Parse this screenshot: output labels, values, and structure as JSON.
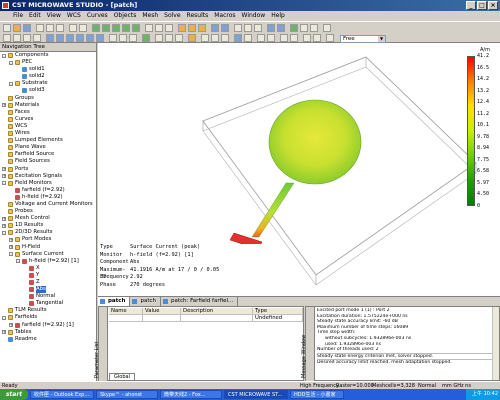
{
  "window": {
    "title": "CST MICROWAVE STUDIO - [patch]"
  },
  "menu": [
    "File",
    "Edit",
    "View",
    "WCS",
    "Curves",
    "Objects",
    "Mesh",
    "Solve",
    "Results",
    "Macros",
    "Window",
    "Help"
  ],
  "toolbar": {
    "view_mode": "Free"
  },
  "navtree": {
    "title": "Navigation Tree",
    "items": [
      {
        "label": "Components",
        "expander": "-",
        "icon": "folder"
      },
      {
        "label": "PEC",
        "expander": "-",
        "icon": "folder"
      },
      {
        "label": "solid1",
        "expander": "",
        "icon": "solid"
      },
      {
        "label": "solid2",
        "expander": "",
        "icon": "solid"
      },
      {
        "label": "Substrate",
        "expander": "-",
        "icon": "folder"
      },
      {
        "label": "solid3",
        "expander": "",
        "icon": "solid"
      },
      {
        "label": "Groups",
        "expander": "",
        "icon": "folder"
      },
      {
        "label": "Materials",
        "expander": "+",
        "icon": "folder"
      },
      {
        "label": "Faces",
        "expander": "",
        "icon": "folder"
      },
      {
        "label": "Curves",
        "expander": "",
        "icon": "folder"
      },
      {
        "label": "WCS",
        "expander": "",
        "icon": "folder"
      },
      {
        "label": "Wires",
        "expander": "",
        "icon": "folder"
      },
      {
        "label": "Lumped Elements",
        "expander": "",
        "icon": "folder"
      },
      {
        "label": "Plane Wave",
        "expander": "",
        "icon": "folder"
      },
      {
        "label": "Farfield Source",
        "expander": "",
        "icon": "folder"
      },
      {
        "label": "Field Sources",
        "expander": "",
        "icon": "folder"
      },
      {
        "label": "Ports",
        "expander": "+",
        "icon": "folder"
      },
      {
        "label": "Excitation Signals",
        "expander": "+",
        "icon": "folder"
      },
      {
        "label": "Field Monitors",
        "expander": "-",
        "icon": "folder"
      },
      {
        "label": "farfield (f=2.92)",
        "expander": "",
        "icon": "mon"
      },
      {
        "label": "h-field (f=2.92)",
        "expander": "",
        "icon": "mon"
      },
      {
        "label": "Voltage and Current Monitors",
        "expander": "",
        "icon": "folder"
      },
      {
        "label": "Probes",
        "expander": "",
        "icon": "folder"
      },
      {
        "label": "Mesh Control",
        "expander": "+",
        "icon": "folder"
      },
      {
        "label": "1D Results",
        "expander": "+",
        "icon": "folder"
      },
      {
        "label": "2D/3D Results",
        "expander": "-",
        "icon": "folder"
      },
      {
        "label": "Port Modes",
        "expander": "+",
        "icon": "folder"
      },
      {
        "label": "H-Field",
        "expander": "+",
        "icon": "folder"
      },
      {
        "label": "Surface Current",
        "expander": "-",
        "icon": "folder"
      },
      {
        "label": "h-field (f=2.92) [1]",
        "expander": "-",
        "icon": "mon"
      },
      {
        "label": "X",
        "expander": "",
        "icon": "mon"
      },
      {
        "label": "Y",
        "expander": "",
        "icon": "mon"
      },
      {
        "label": "Z",
        "expander": "",
        "icon": "mon"
      },
      {
        "label": "Abs",
        "expander": "",
        "icon": "mon",
        "selected": true
      },
      {
        "label": "Normal",
        "expander": "",
        "icon": "mon"
      },
      {
        "label": "Tangential",
        "expander": "",
        "icon": "mon"
      },
      {
        "label": "TLM Results",
        "expander": "",
        "icon": "folder"
      },
      {
        "label": "Farfields",
        "expander": "-",
        "icon": "folder"
      },
      {
        "label": "farfield (f=2.92) [1]",
        "expander": "+",
        "icon": "mon"
      },
      {
        "label": "Tables",
        "expander": "+",
        "icon": "folder"
      },
      {
        "label": "Readme",
        "expander": "",
        "icon": "solid"
      }
    ]
  },
  "info": [
    {
      "key": "Type",
      "value": "Surface Current (peak)"
    },
    {
      "key": "Monitor",
      "value": "h-field (f=2.92) [1]"
    },
    {
      "key": "Component",
      "value": "Abs"
    },
    {
      "key": "Maximum-3D",
      "value": "41.1916 A/m at 17 / 0 / 0.05"
    },
    {
      "key": "Frequency",
      "value": "2.92"
    },
    {
      "key": "Phase",
      "value": "270 degrees"
    }
  ],
  "legend": {
    "unit": "A/m",
    "ticks": [
      "41.2",
      "16.5",
      "14.2",
      "13.2",
      "12.4",
      "11.2",
      "10.1",
      "9.78",
      "8.94",
      "7.75",
      "6.58",
      "5.97",
      "4.50",
      "0"
    ]
  },
  "colors": {
    "patch": "#cde233",
    "feed": "#7dcf3a",
    "port": "#e03030",
    "board_edge": "#9a9a9a"
  },
  "view_tabs": [
    {
      "label": "patch",
      "active": true
    },
    {
      "label": "patch",
      "active": false
    },
    {
      "label": "patch: Farfield farfiel...",
      "active": false
    }
  ],
  "params": {
    "title": "Parameter List",
    "headers": [
      "Name",
      "Value",
      "Description",
      "Type"
    ],
    "rows": [
      [
        "",
        "",
        "",
        "Undefined"
      ]
    ],
    "tab": "Global"
  },
  "messages": {
    "title": "Message Window",
    "lines": [
      {
        "text": "Excited port mode 1 (1) : Port 2",
        "indent": false,
        "sep": false
      },
      {
        "text": "Excitation duration: 1.575224e+000 ns",
        "indent": false,
        "sep": false
      },
      {
        "text": "Steady state accuracy limit: -60 dB",
        "indent": false,
        "sep": false
      },
      {
        "text": "Maximum number of time steps: 16089",
        "indent": false,
        "sep": false
      },
      {
        "text": "Time step width:",
        "indent": false,
        "sep": false
      },
      {
        "text": "without subcycles: 1.932896e-003 ns",
        "indent": true,
        "sep": false
      },
      {
        "text": "used: 1.932896e-003 ns",
        "indent": true,
        "sep": false
      },
      {
        "text": "Number of threads used: 2",
        "indent": false,
        "sep": false
      },
      {
        "text": "Steady state energy criterion met, solver stopped.",
        "indent": false,
        "sep": true
      },
      {
        "text": "Desired accuracy limit reached, mesh adaptation stopped.",
        "indent": false,
        "sep": true
      }
    ]
  },
  "statusbar": {
    "ready": "Ready",
    "freq": "High Frequency",
    "raster": "Raster=10.000",
    "meshcells": "Meshcells=3,328",
    "normal": "Normal",
    "units": "mm GHz ns"
  },
  "taskbar": {
    "start": "start",
    "tasks": [
      {
        "label": "收件匣 - Outlook Exp...",
        "active": false
      },
      {
        "label": "Skype™ - ahonst",
        "active": false
      },
      {
        "label": "微带天线2 - Fox...",
        "active": false
      },
      {
        "label": "CST MICROWAVE ST...",
        "active": true
      },
      {
        "label": "HDD生活 - 小書家",
        "active": false
      }
    ],
    "clock": "上午 10:42"
  }
}
